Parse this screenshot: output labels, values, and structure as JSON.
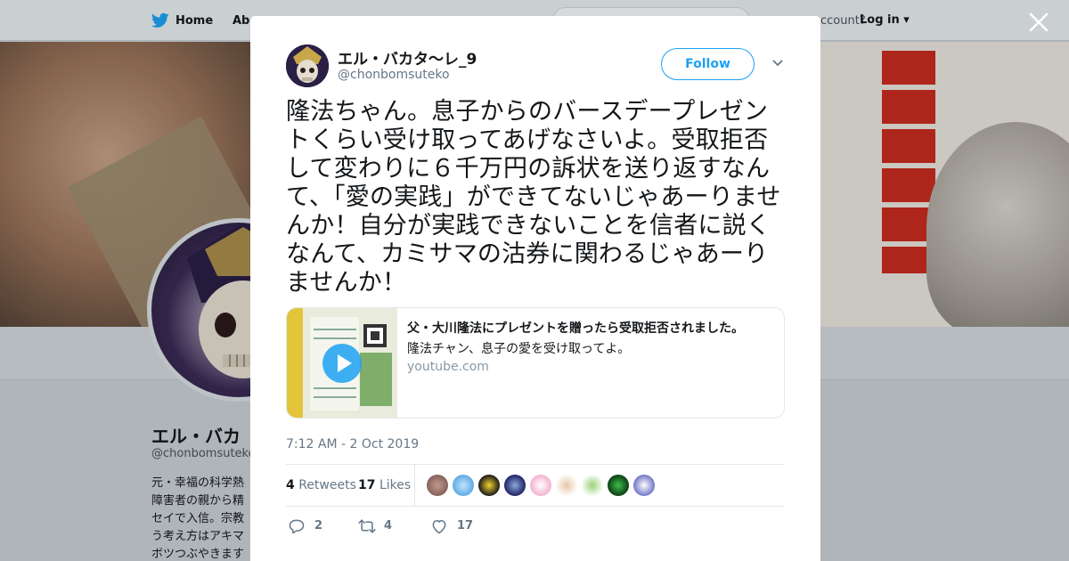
{
  "nav": {
    "home_label": "Home",
    "about_label": "Abo",
    "account_prompt": "ccount?",
    "login_label": "Log in"
  },
  "profile": {
    "name": "エル・バカ",
    "handle": "@chonbomsuteko",
    "bio_lines": [
      "元・幸福の科学熱",
      "障害者の親から精",
      "セイで入信。宗教",
      "う考え方はアキマ",
      "ボツつぶやきます"
    ]
  },
  "tweet": {
    "author_name": "エル・バカタ～レ_9",
    "author_handle": "@chonbomsuteko",
    "follow_label": "Follow",
    "text": "隆法ちゃん。息子からのバースデープレゼントくらい受け取ってあげなさいよ。受取拒否して変わりに６千万円の訴状を送り返すなんて、「愛の実践」ができてないじゃあーりませんか！自分が実践できないことを信者に説くなんて、カミサマの沽券に関わるじゃあーりませんか！",
    "card": {
      "title": "父・大川隆法にプレゼントを贈ったら受取拒否されました。",
      "description": "隆法チャン、息子の愛を受け取ってよ。",
      "domain": "youtube.com"
    },
    "timestamp": "7:12 AM - 2 Oct 2019",
    "retweets_count": "4",
    "retweets_label": "Retweets",
    "likes_count": "17",
    "likes_label": "Likes",
    "actions": {
      "reply_count": "2",
      "retweet_count": "4",
      "like_count": "17"
    }
  },
  "colors": {
    "accent": "#1da1f2",
    "text": "#14171a",
    "secondary": "#657786"
  },
  "icons": [
    "twitter-bird-icon",
    "close-icon",
    "chevron-down-icon",
    "play-icon",
    "reply-icon",
    "retweet-icon",
    "heart-icon"
  ]
}
